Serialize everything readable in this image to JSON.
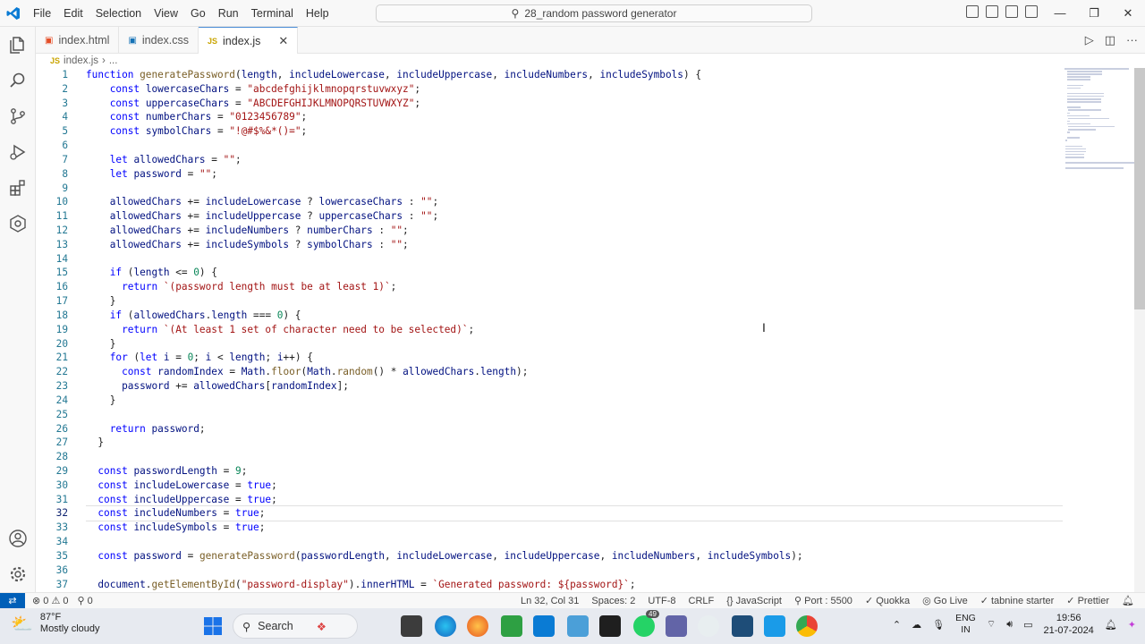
{
  "titlebar": {
    "menu": [
      "File",
      "Edit",
      "Selection",
      "View",
      "Go",
      "Run",
      "Terminal",
      "Help"
    ],
    "command_center": "28_random password generator"
  },
  "tabs": [
    {
      "label": "index.html",
      "icon": "html-icon",
      "active": false
    },
    {
      "label": "index.css",
      "icon": "css-icon",
      "active": false
    },
    {
      "label": "index.js",
      "icon": "js-icon",
      "active": true
    }
  ],
  "breadcrumb": {
    "file": "index.js",
    "rest": "..."
  },
  "editor": {
    "current_line": 32,
    "lines": [
      "function generatePassword(length, includeLowercase, includeUppercase, includeNumbers, includeSymbols) {",
      "    const lowercaseChars = \"abcdefghijklmnopqrstuvwxyz\";",
      "    const uppercaseChars = \"ABCDEFGHIJKLMNOPQRSTUVWXYZ\";",
      "    const numberChars = \"0123456789\";",
      "    const symbolChars = \"!@#$%&*()=\";",
      "",
      "    let allowedChars = \"\";",
      "    let password = \"\";",
      "",
      "    allowedChars += includeLowercase ? lowercaseChars : \"\";",
      "    allowedChars += includeUppercase ? uppercaseChars : \"\";",
      "    allowedChars += includeNumbers ? numberChars : \"\";",
      "    allowedChars += includeSymbols ? symbolChars : \"\";",
      "",
      "    if (length <= 0) {",
      "      return `(password length must be at least 1)`;",
      "    }",
      "    if (allowedChars.length === 0) {",
      "      return `(At least 1 set of character need to be selected)`;",
      "    }",
      "    for (let i = 0; i < length; i++) {",
      "      const randomIndex = Math.floor(Math.random() * allowedChars.length);",
      "      password += allowedChars[randomIndex];",
      "    }",
      "",
      "    return password;",
      "  }",
      "",
      "  const passwordLength = 9;",
      "  const includeLowercase = true;",
      "  const includeUppercase = true;",
      "  const includeNumbers = true;",
      "  const includeSymbols = true;",
      "",
      "  const password = generatePassword(passwordLength, includeLowercase, includeUppercase, includeNumbers, includeSymbols);",
      "",
      "  document.getElementById(\"password-display\").innerHTML = `Generated password: ${password}`;"
    ]
  },
  "statusbar": {
    "errors": "⊗ 0 ⚠ 0",
    "ports": "⚲ 0",
    "position": "Ln 32, Col 31",
    "spaces": "Spaces: 2",
    "encoding": "UTF-8",
    "eol": "CRLF",
    "language": "{} JavaScript",
    "port": "⚲ Port : 5500",
    "quokka": "✓ Quokka",
    "golive": "◎ Go Live",
    "tabnine": "✓ tabnine starter",
    "prettier": "✓ Prettier"
  },
  "taskbar": {
    "weather_temp": "87°F",
    "weather_desc": "Mostly cloudy",
    "search_label": "Search",
    "lang_top": "ENG",
    "lang_bottom": "IN",
    "time": "19:56",
    "date": "21-07-2024",
    "badge": "49"
  },
  "colors": {
    "accent": "#005fb8",
    "keyword": "#0000ff",
    "string": "#a31515",
    "number": "#098658",
    "function": "#795e26"
  }
}
